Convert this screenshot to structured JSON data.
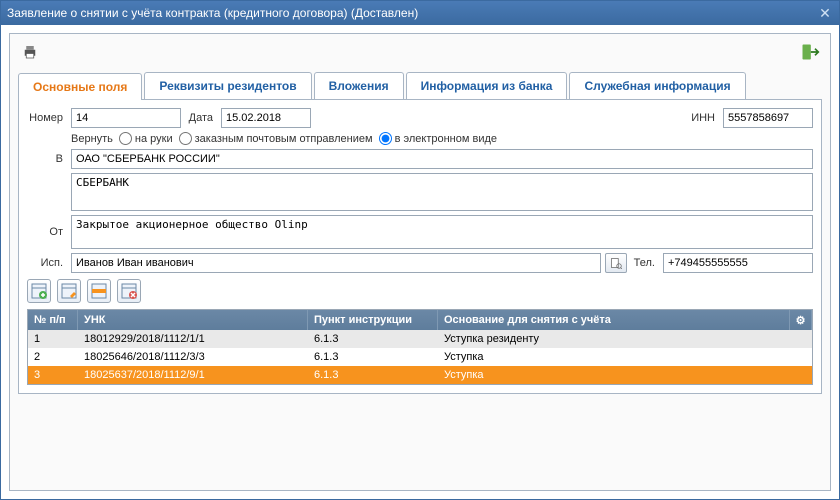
{
  "window": {
    "title": "Заявление о снятии с учёта контракта (кредитного договора) (Доставлен)"
  },
  "tabs": [
    "Основные поля",
    "Реквизиты резидентов",
    "Вложения",
    "Информация из банка",
    "Служебная информация"
  ],
  "form": {
    "number_label": "Номер",
    "number": "14",
    "date_label": "Дата",
    "date": "15.02.2018",
    "inn_label": "ИНН",
    "inn": "5557858697",
    "return_label": "Вернуть",
    "return_options": {
      "hands": "на руки",
      "registered": "заказным почтовым отправлением",
      "electronic": "в электронном виде"
    },
    "to_label": "В",
    "to_bank": "ОАО \"СБЕРБАНК РОССИИ\"",
    "to_bank2": "СБЕРБАНК",
    "from_label": "От",
    "from": "Закрытое акционерное общество Olinp",
    "executor_label": "Исп.",
    "executor": "Иванов Иван иванович",
    "tel_label": "Тел.",
    "tel": "+749455555555"
  },
  "grid": {
    "headers": {
      "num": "№ п/п",
      "unk": "УНК",
      "instr": "Пункт инструкции",
      "reason": "Основание для снятия с учёта"
    },
    "rows": [
      {
        "num": "1",
        "unk": "18012929/2018/1112/1/1",
        "instr": "6.1.3",
        "reason": "Уступка резиденту"
      },
      {
        "num": "2",
        "unk": "18025646/2018/1112/3/3",
        "instr": "6.1.3",
        "reason": "Уступка"
      },
      {
        "num": "3",
        "unk": "18025637/2018/1112/9/1",
        "instr": "6.1.3",
        "reason": "Уступка"
      }
    ]
  }
}
